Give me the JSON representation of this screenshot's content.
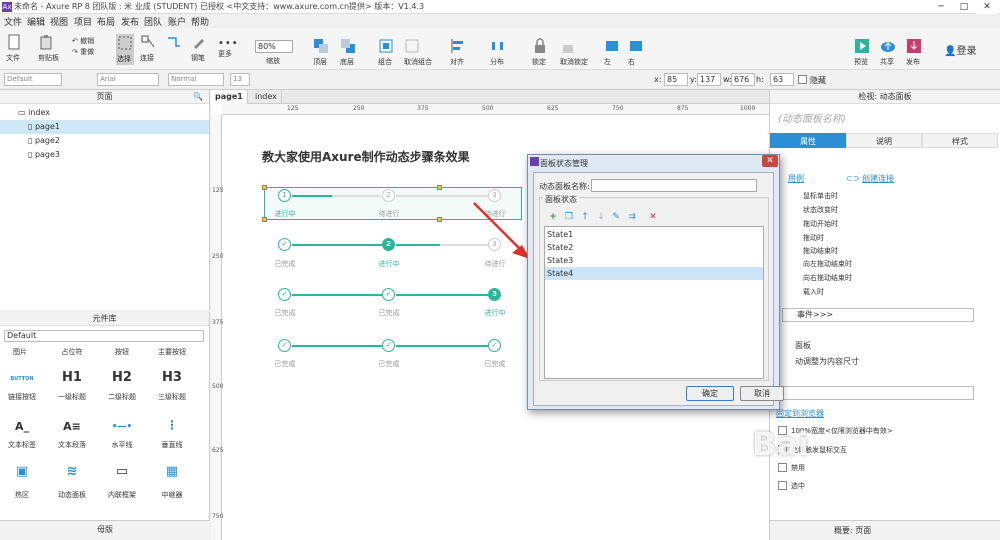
{
  "window": {
    "title": "未命名 - Axure RP 8 团队版 : 米 业成 (STUDENT) 已授权    <中文支持：www.axure.com.cn提供> 版本：V1.4.3"
  },
  "menu": [
    "文件",
    "编辑",
    "视图",
    "项目",
    "布局",
    "发布",
    "团队",
    "账户",
    "帮助"
  ],
  "toolbar": {
    "file": "文件",
    "clipboard": "剪贴板",
    "undo": "撤销",
    "redo": "重做",
    "select": "选择",
    "connect": "连接",
    "pen": "钢笔",
    "more": "更多",
    "zoom_value": "80%",
    "zoom_label": "缩放",
    "top": "顶层",
    "bottom": "底层",
    "group": "组合",
    "ungroup": "取消组合",
    "align": "对齐",
    "distribute": "分布",
    "lock": "锁定",
    "unlock": "取消锁定",
    "left": "左",
    "right": "右",
    "preview": "预览",
    "share": "共享",
    "publish": "发布",
    "login": "登录"
  },
  "format": {
    "style": "Default",
    "font": "Arial",
    "weight": "Normal",
    "size": "13",
    "x_label": "x:",
    "x": "85",
    "y_label": "y:",
    "y": "137",
    "w_label": "w:",
    "w": "676",
    "h_label": "h:",
    "h": "63",
    "hidden": "隐藏"
  },
  "pages_panel": {
    "title": "页面",
    "root": "index",
    "pages": [
      "page1",
      "page2",
      "page3"
    ]
  },
  "widgets_panel": {
    "title": "元件库",
    "library": "Default",
    "row0": [
      "图片",
      "占位符",
      "按钮",
      "主要按钮"
    ],
    "row1": [
      {
        "glyph": "BUTTON",
        "label": "链接按钮"
      },
      {
        "glyph": "H1",
        "label": "一级标题"
      },
      {
        "glyph": "H2",
        "label": "二级标题"
      },
      {
        "glyph": "H3",
        "label": "三级标题"
      }
    ],
    "row2": [
      {
        "glyph": "A_",
        "label": "文本标签"
      },
      {
        "glyph": "A≡",
        "label": "文本段落"
      },
      {
        "glyph": "•—•",
        "label": "水平线"
      },
      {
        "glyph": "⋮",
        "label": "垂直线"
      }
    ],
    "row3": [
      {
        "glyph": "▣",
        "label": "热区"
      },
      {
        "glyph": "≋",
        "label": "动态面板"
      },
      {
        "glyph": "▭",
        "label": "内联框架"
      },
      {
        "glyph": "▦",
        "label": "中继器"
      }
    ]
  },
  "masters_panel": {
    "title": "母版"
  },
  "tabs": [
    "page1",
    "index"
  ],
  "ruler": {
    "h": [
      "125",
      "250",
      "375",
      "500",
      "625",
      "750",
      "875",
      "1000"
    ],
    "v": [
      "125",
      "250",
      "375",
      "500",
      "625",
      "750"
    ]
  },
  "canvas": {
    "heading": "教大家使用Axure制作动态步骤条效果",
    "rows": [
      {
        "steps": [
          {
            "n": "1",
            "label": "进行中",
            "state": "current"
          },
          {
            "n": "2",
            "label": "待进行",
            "state": "todo"
          },
          {
            "n": "3",
            "label": "待进行",
            "state": "todo"
          }
        ]
      },
      {
        "steps": [
          {
            "n": "✓",
            "label": "已完成",
            "state": "done"
          },
          {
            "n": "2",
            "label": "进行中",
            "state": "active"
          },
          {
            "n": "3",
            "label": "待进行",
            "state": "todo"
          }
        ]
      },
      {
        "steps": [
          {
            "n": "✓",
            "label": "已完成",
            "state": "done"
          },
          {
            "n": "✓",
            "label": "已完成",
            "state": "done"
          },
          {
            "n": "3",
            "label": "进行中",
            "state": "active"
          }
        ]
      },
      {
        "steps": [
          {
            "n": "✓",
            "label": "已完成",
            "state": "done"
          },
          {
            "n": "✓",
            "label": "已完成",
            "state": "done"
          },
          {
            "n": "✓",
            "label": "已完成",
            "state": "done"
          }
        ]
      }
    ]
  },
  "dialog": {
    "title": "面板状态管理",
    "name_label": "动态面板名称:",
    "states_label": "面板状态",
    "states": [
      "State1",
      "State2",
      "State3",
      "State4"
    ],
    "selected": 3,
    "ok": "确定",
    "cancel": "取消"
  },
  "right_panel": {
    "header": "检视: 动态面板",
    "panel_name_placeholder": "(动态面板名称)",
    "tabs": [
      "属性",
      "说明",
      "样式"
    ],
    "use_case": "用例",
    "create_link": "创建连接",
    "events": [
      "鼠标单击时",
      "状态改变时",
      "拖动开始时",
      "拖动时",
      "拖动结束时",
      "向左拖动结束时",
      "向右拖动结束时",
      "载入时"
    ],
    "more_events": "事件>>>",
    "panel_section": "面板",
    "auto_fit": "动调整为内容尺寸",
    "browser_link": "固定到浏览器",
    "opt1": "100%宽度<仅限浏览器中有效>",
    "opt2": "允许触发鼠标交互",
    "opt3": "禁用",
    "opt4": "选中",
    "status": "概要: 页面"
  },
  "colors": {
    "accent": "#2bb59a",
    "selection_blue": "#2b8fd6"
  }
}
